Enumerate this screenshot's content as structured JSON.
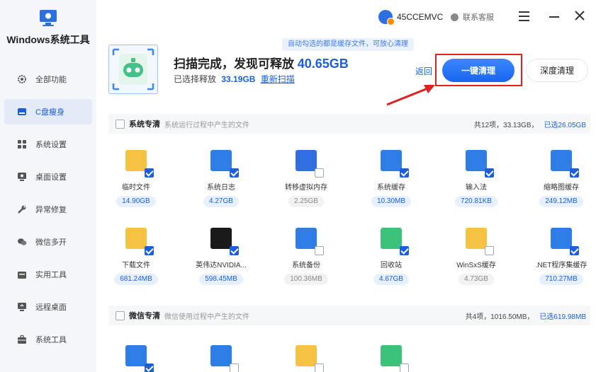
{
  "app": {
    "title": "Windows系统工具"
  },
  "sidebar": {
    "items": [
      {
        "label": "全部功能",
        "icon": "gear-icon"
      },
      {
        "label": "C盘瘦身",
        "icon": "c-drive-icon",
        "active": true
      },
      {
        "label": "系统设置",
        "icon": "grid-icon"
      },
      {
        "label": "桌面设置",
        "icon": "monitor-icon"
      },
      {
        "label": "异常修复",
        "icon": "wrench-icon"
      },
      {
        "label": "微信多开",
        "icon": "wechat-icon"
      },
      {
        "label": "实用工具",
        "icon": "toolbox-icon"
      },
      {
        "label": "远程桌面",
        "icon": "remote-icon"
      },
      {
        "label": "系统工具",
        "icon": "briefcase-icon"
      }
    ]
  },
  "header": {
    "username": "45CCEMVC",
    "support": "联系客服",
    "tip": "自动勾选的都是缓存文件，可放心清理"
  },
  "scan": {
    "title_prefix": "扫描完成，发现可释放",
    "total": "40.65GB",
    "selected_label": "已选择释放",
    "selected": "33.19GB",
    "rescan": "重新扫描",
    "back": "返回",
    "one_click": "一键清理",
    "deep_clean": "深度清理"
  },
  "sections": [
    {
      "name": "系统专清",
      "desc": "系统运行过程中产生的文件",
      "count": "共12项，33.13GB，",
      "selected": "已选26.05GB",
      "items": [
        {
          "name": "临时文件",
          "size": "14.90GB",
          "checked": true,
          "color": "#f6c244"
        },
        {
          "name": "系统日志",
          "size": "4.27GB",
          "checked": true,
          "color": "#2f7ee8"
        },
        {
          "name": "转移虚拟内存",
          "size": "2.25GB",
          "checked": false,
          "color": "#2f6fe0"
        },
        {
          "name": "系统缓存",
          "size": "10.30MB",
          "checked": true,
          "color": "#2f7ee8"
        },
        {
          "name": "输入法",
          "size": "720.81KB",
          "checked": true,
          "color": "#2f7ee8"
        },
        {
          "name": "缩略图缓存",
          "size": "249.12MB",
          "checked": true,
          "color": "#2f7ee8"
        },
        {
          "name": "下载文件",
          "size": "681.24MB",
          "checked": true,
          "color": "#f6c244"
        },
        {
          "name": "英伟达NVIDIA...",
          "size": "598.45MB",
          "checked": true,
          "color": "#1a1a1a"
        },
        {
          "name": "系统备份",
          "size": "100.36MB",
          "checked": false,
          "color": "#2f7ee8"
        },
        {
          "name": "回收站",
          "size": "4.67GB",
          "checked": true,
          "color": "#3cc27a"
        },
        {
          "name": "WinSxS缓存",
          "size": "4.73GB",
          "checked": false,
          "color": "#f6c244"
        },
        {
          "name": ".NET程序集缓存",
          "size": "710.27MB",
          "checked": true,
          "color": "#2f7ee8"
        }
      ]
    },
    {
      "name": "微信专清",
      "desc": "微信使用过程中产生的文件",
      "count": "共4项，1016.50MB，",
      "selected": "已选619.98MB",
      "items": [
        {
          "checked": true,
          "color": "#2f7ee8"
        },
        {
          "checked": false,
          "color": "#2f7ee8"
        },
        {
          "checked": false,
          "color": "#f6c244"
        },
        {
          "checked": false,
          "color": "#3cc27a"
        }
      ]
    }
  ]
}
